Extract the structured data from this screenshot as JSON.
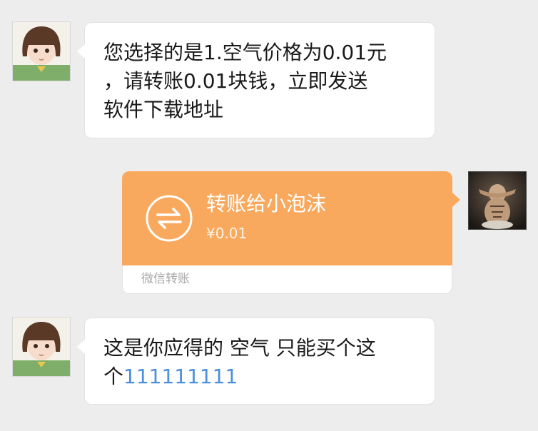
{
  "messages": [
    {
      "side": "left",
      "lines": [
        "您选择的是1.空气价格为0.01元",
        "，请转账0.01块钱，立即发送",
        "软件下载地址"
      ]
    },
    {
      "side": "right",
      "type": "transfer",
      "title": "转账给小泡沫",
      "amount": "¥0.01",
      "footer": "微信转账",
      "icon": "transfer-arrows-icon"
    },
    {
      "side": "left",
      "line1": "这是你应得的 空气 只能买个这",
      "line2_prefix": "个",
      "line2_link": "111111111"
    }
  ],
  "colors": {
    "background": "#ededed",
    "bubble": "#ffffff",
    "transfer": "#f9a95e",
    "link": "#4a8fe0"
  }
}
